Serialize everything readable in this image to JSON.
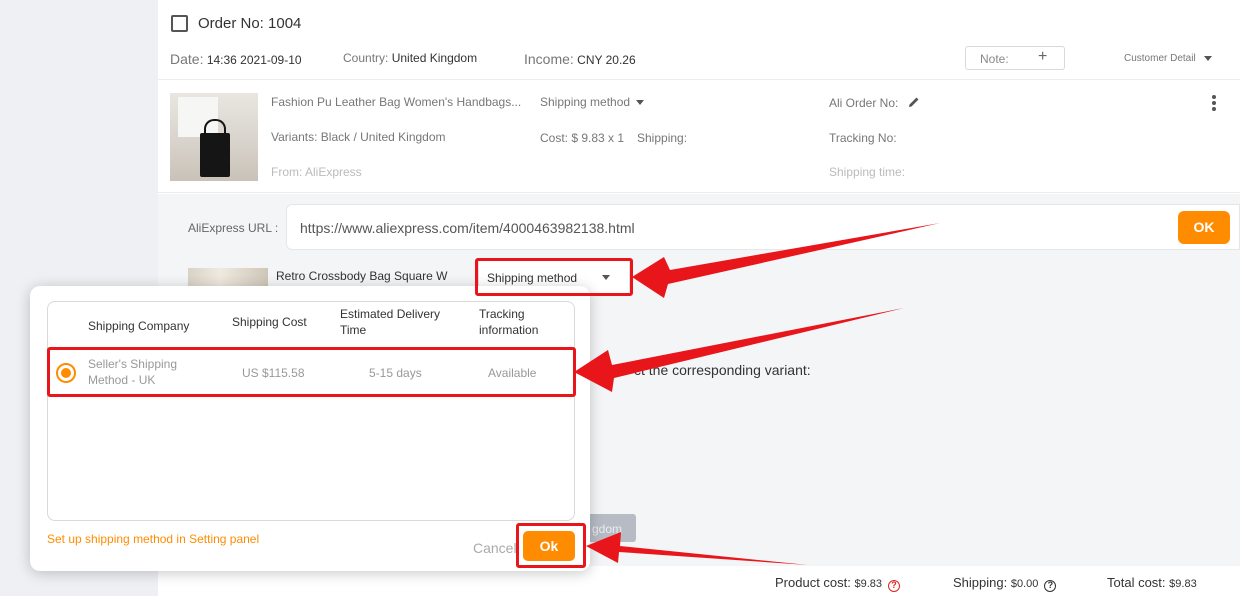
{
  "order": {
    "title": "Order No: 1004",
    "date_label": "Date:",
    "date_value": "14:36 2021-09-10",
    "country_label": "Country:",
    "country_value": "United Kingdom",
    "income_label": "Income:",
    "income_value": "CNY 20.26",
    "note_label": "Note:",
    "note_plus": "+",
    "customer_detail": "Customer Detail"
  },
  "product": {
    "name": "Fashion Pu Leather Bag Women's Handbags...",
    "variants": "Variants: Black / United Kingdom",
    "from": "From: AliExpress",
    "shipping_method": "Shipping method",
    "cost": "Cost: $ 9.83 x 1",
    "shipping": "Shipping:",
    "ali_order_no": "Ali Order No:",
    "tracking_no": "Tracking No:",
    "shipping_time": "Shipping time:"
  },
  "aliexpress": {
    "url_label": "AliExpress URL :",
    "url_value": "https://www.aliexpress.com/item/4000463982138.html",
    "ok_label": "OK",
    "item_title": "Retro Crossbody Bag Square W",
    "shipping_method_label": "Shipping method",
    "corresponding_text": "ct the corresponding variant:",
    "kingdom_btn": "gdom"
  },
  "popup": {
    "headers": [
      "Shipping Company",
      "Shipping Cost",
      "Estimated Delivery Time",
      "Tracking information"
    ],
    "header_lines": [
      [
        "Shipping Company"
      ],
      [
        "Shipping Cost"
      ],
      [
        "Estimated Delivery",
        "Time"
      ],
      [
        "Tracking",
        "information"
      ]
    ],
    "row": {
      "company_line1": "Seller's Shipping",
      "company_line2": "Method - UK",
      "cost": "US $115.58",
      "delivery": "5-15 days",
      "tracking": "Available",
      "selected": true
    },
    "setup_link": "Set up shipping method in Setting panel",
    "cancel_label": "Cancel",
    "ok_label": "Ok"
  },
  "footer": {
    "product_cost_label": "Product cost:",
    "product_cost_value": "$9.83",
    "shipping_label": "Shipping:",
    "shipping_value": "$0.00",
    "total_label": "Total cost:",
    "total_value": "$9.83"
  },
  "colors": {
    "accent": "#ff8c00",
    "annotation_red": "#e8151b",
    "sidebar_bg": "#eef0f3"
  },
  "icons": [
    "checkbox-icon",
    "pencil-icon",
    "more-vertical-icon",
    "chevron-down-icon",
    "help-icon",
    "plus-icon"
  ]
}
